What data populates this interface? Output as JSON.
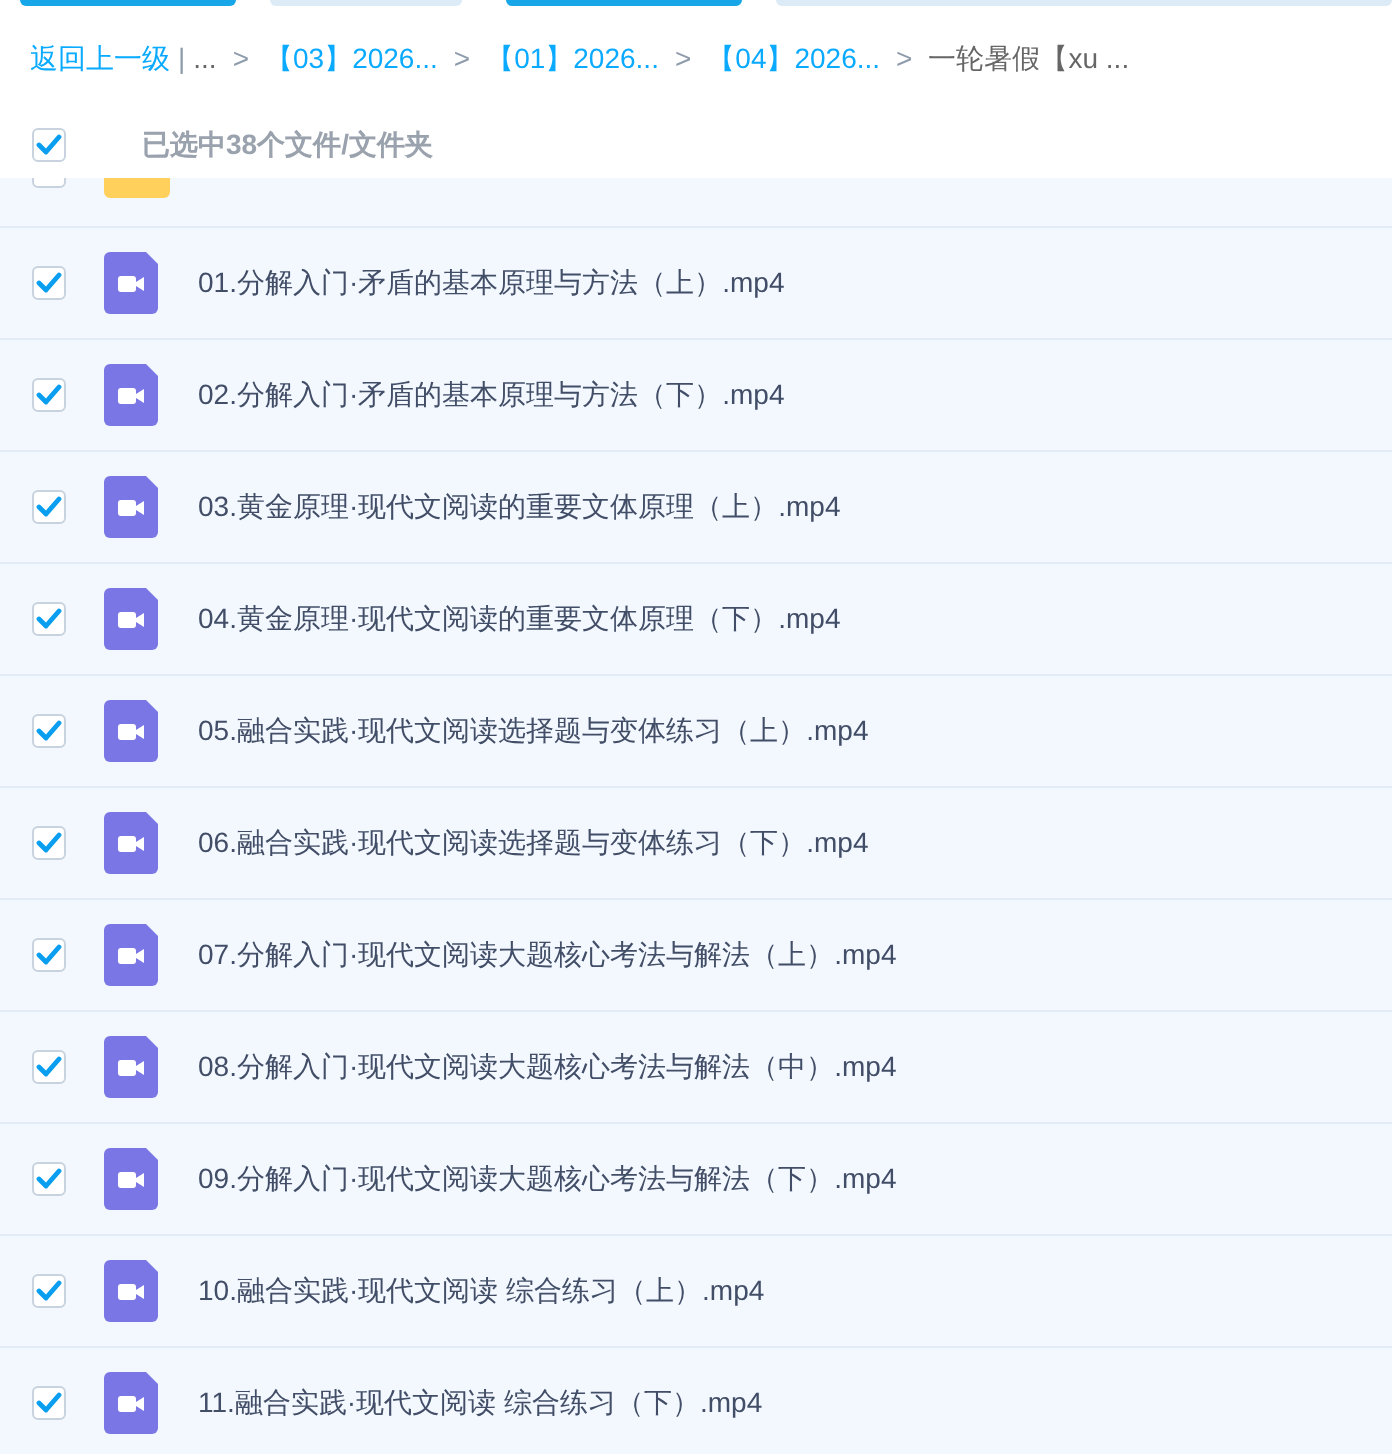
{
  "breadcrumb": {
    "back": "返回上一级",
    "divider": "|",
    "items": [
      {
        "label": "...",
        "kind": "muted"
      },
      {
        "label": "【03】2026...",
        "kind": "link",
        "separator": ">"
      },
      {
        "label": "【01】2026...",
        "kind": "link",
        "separator": ">"
      },
      {
        "label": "【04】2026...",
        "kind": "link",
        "separator": ">"
      },
      {
        "label": "一轮暑假【xu ...",
        "kind": "current",
        "separator": ">"
      }
    ]
  },
  "selection": {
    "checked": true,
    "label": "已选中38个文件/文件夹"
  },
  "files": [
    {
      "kind": "folder",
      "checked": false
    },
    {
      "kind": "video",
      "checked": true,
      "name": "01.分解入门·矛盾的基本原理与方法（上）.mp4"
    },
    {
      "kind": "video",
      "checked": true,
      "name": "02.分解入门·矛盾的基本原理与方法（下）.mp4"
    },
    {
      "kind": "video",
      "checked": true,
      "name": "03.黄金原理·现代文阅读的重要文体原理（上）.mp4"
    },
    {
      "kind": "video",
      "checked": true,
      "name": "04.黄金原理·现代文阅读的重要文体原理（下）.mp4"
    },
    {
      "kind": "video",
      "checked": true,
      "name": "05.融合实践·现代文阅读选择题与变体练习（上）.mp4"
    },
    {
      "kind": "video",
      "checked": true,
      "name": "06.融合实践·现代文阅读选择题与变体练习（下）.mp4"
    },
    {
      "kind": "video",
      "checked": true,
      "name": "07.分解入门·现代文阅读大题核心考法与解法（上）.mp4"
    },
    {
      "kind": "video",
      "checked": true,
      "name": "08.分解入门·现代文阅读大题核心考法与解法（中）.mp4"
    },
    {
      "kind": "video",
      "checked": true,
      "name": "09.分解入门·现代文阅读大题核心考法与解法（下）.mp4"
    },
    {
      "kind": "video",
      "checked": true,
      "name": "10.融合实践·现代文阅读 综合练习（上）.mp4"
    },
    {
      "kind": "video",
      "checked": true,
      "name": "11.融合实践·现代文阅读 综合练习（下）.mp4"
    }
  ]
}
